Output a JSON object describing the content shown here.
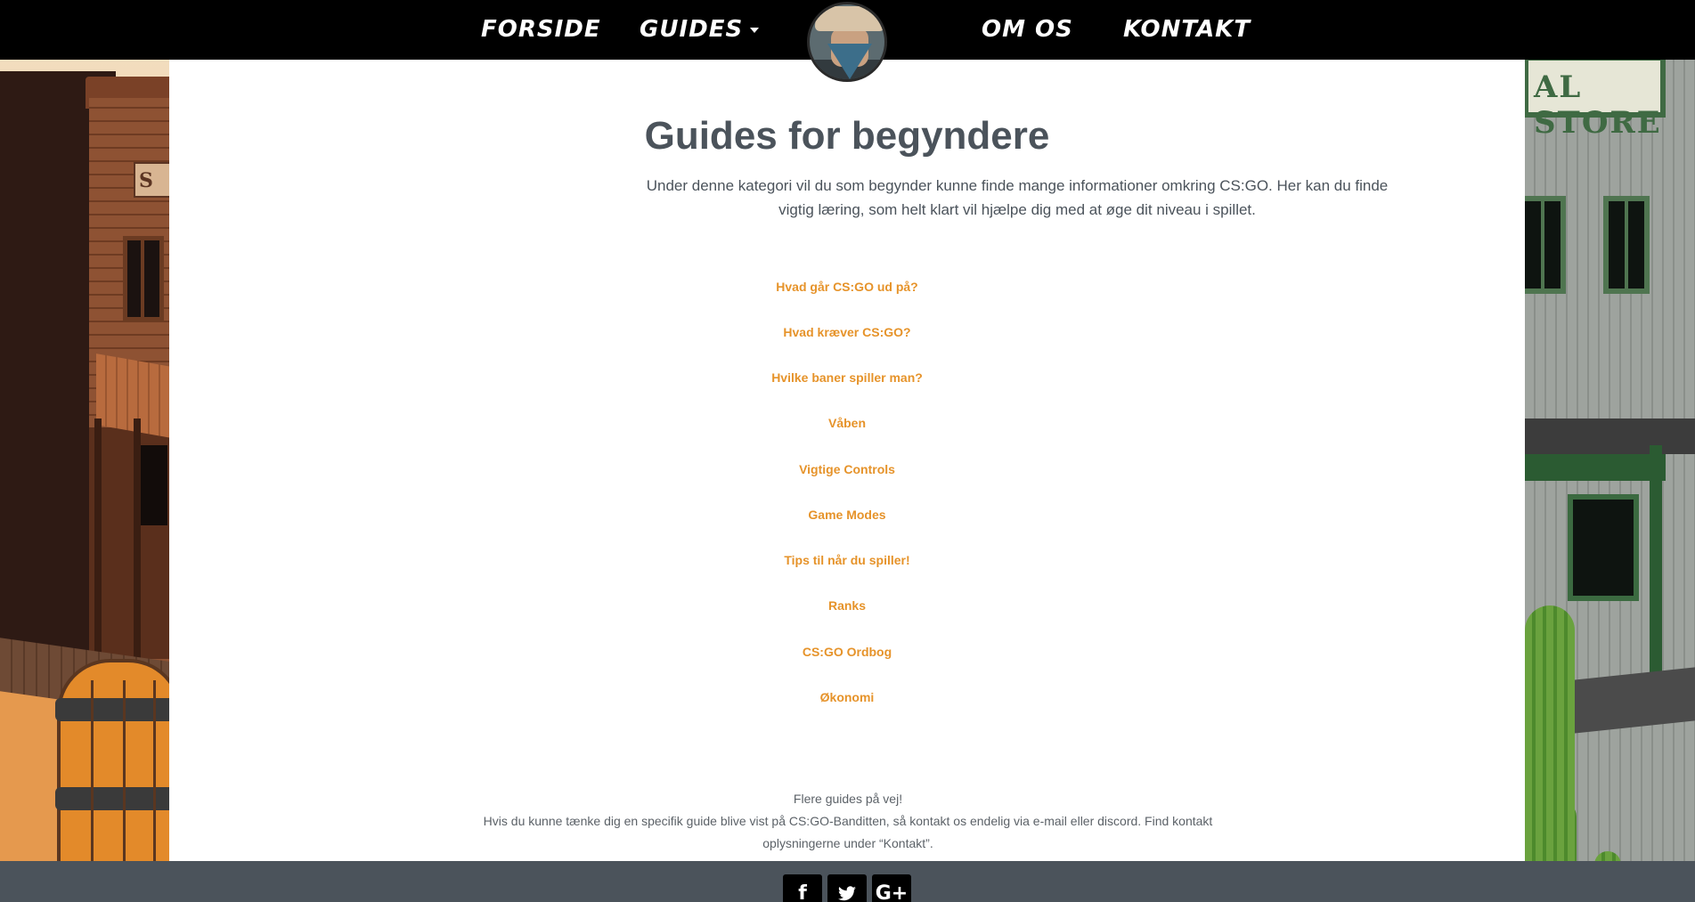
{
  "nav": {
    "items": [
      {
        "label": "FORSIDE"
      },
      {
        "label": "GUIDES"
      },
      {
        "label": "OM OS"
      },
      {
        "label": "KONTAKT"
      }
    ]
  },
  "main": {
    "title": "Guides for begyndere",
    "intro_line1": "Under denne kategori vil du som begynder kunne finde mange informationer omkring CS:GO. Her kan du finde",
    "intro_line2": "vigtig læring, som helt klart vil hjælpe dig med at øge dit niveau i spillet.",
    "guides": [
      {
        "label": "Hvad går CS:GO ud på?"
      },
      {
        "label": "Hvad kræver CS:GO?"
      },
      {
        "label": "Hvilke baner spiller man?"
      },
      {
        "label": "Våben"
      },
      {
        "label": "Vigtige Controls"
      },
      {
        "label": "Game Modes"
      },
      {
        "label": "Tips til når du spiller!"
      },
      {
        "label": "Ranks"
      },
      {
        "label": "CS:GO Ordbog"
      },
      {
        "label": "Økonomi"
      }
    ],
    "footer_note": {
      "line1": "Flere guides på vej!",
      "line2": "Hvis du kunne tænke dig en specifik guide blive vist på CS:GO-Banditten, så kontakt os endelig via e-mail eller discord. Find kontakt",
      "line3": "oplysningerne under “Kontakt”."
    }
  },
  "background": {
    "sign_text": "AL STORE",
    "sign_left_text": "S"
  },
  "social": [
    {
      "icon": "facebook-icon",
      "glyph": "f"
    },
    {
      "icon": "twitter-icon",
      "glyph": "🐦"
    },
    {
      "icon": "google-plus-icon",
      "glyph": "G+"
    }
  ],
  "colors": {
    "nav_bg": "#000000",
    "title": "#4b535b",
    "link": "#e6932a",
    "footer_bg": "#4b535b"
  }
}
